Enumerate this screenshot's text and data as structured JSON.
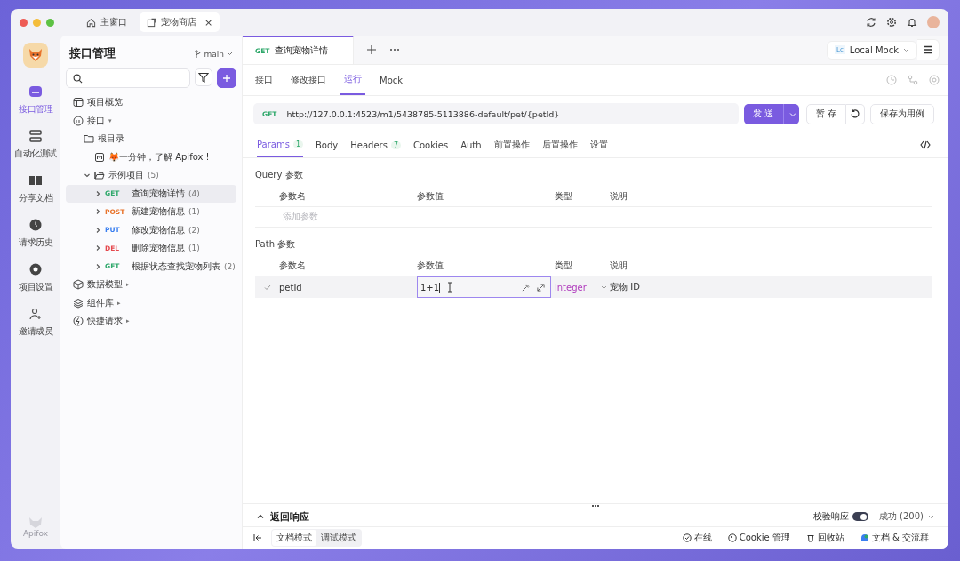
{
  "window": {
    "tabs": [
      {
        "label": "主窗口",
        "kind": "home",
        "selected": false
      },
      {
        "label": "宠物商店",
        "kind": "project",
        "selected": true,
        "close": "×"
      }
    ]
  },
  "rail": {
    "items": [
      {
        "label": "接口管理",
        "kind": "api",
        "selected": true
      },
      {
        "label": "自动化测试",
        "kind": "test",
        "selected": false
      },
      {
        "label": "分享文档",
        "kind": "book",
        "selected": false
      },
      {
        "label": "请求历史",
        "kind": "clock",
        "selected": false
      },
      {
        "label": "项目设置",
        "kind": "gear",
        "selected": false
      },
      {
        "label": "邀请成员",
        "kind": "invite",
        "selected": false
      }
    ],
    "footer": "Apifox"
  },
  "sidebar": {
    "title": "接口管理",
    "branch": "main",
    "tree": [
      {
        "label": "项目概览",
        "kind": "overview",
        "selected": false
      },
      {
        "label": "接口",
        "kind": "api",
        "selected": false,
        "caret": "▾",
        "children": [
          {
            "label": "根目录",
            "kind": "folder",
            "selected": false,
            "children": [
              {
                "label": "🦊一分钟，了解 Apifox !",
                "kind": "doc",
                "selected": false
              }
            ]
          },
          {
            "label": "示例项目",
            "kind": "folder-open",
            "count": "(5)",
            "expanded": true,
            "selected": false,
            "children": [
              {
                "label": "查询宠物详情",
                "kind": "endpoint",
                "method": "GET",
                "color": "#2fa86b",
                "count": "(4)",
                "expanded": false,
                "selected": true
              },
              {
                "label": "新建宠物信息",
                "kind": "endpoint",
                "method": "POST",
                "color": "#e8742c",
                "count": "(1)",
                "expanded": false,
                "selected": false
              },
              {
                "label": "修改宠物信息",
                "kind": "endpoint",
                "method": "PUT",
                "color": "#3a7ff0",
                "count": "(2)",
                "expanded": false,
                "selected": false
              },
              {
                "label": "删除宠物信息",
                "kind": "endpoint",
                "method": "DEL",
                "color": "#e5484d",
                "count": "(1)",
                "expanded": false,
                "selected": false
              },
              {
                "label": "根据状态查找宠物列表",
                "kind": "endpoint",
                "method": "GET",
                "color": "#2fa86b",
                "count": "(2)",
                "expanded": false,
                "selected": false
              }
            ]
          }
        ]
      },
      {
        "label": "数据模型",
        "kind": "model",
        "caret": "▸",
        "selected": false
      },
      {
        "label": "组件库",
        "kind": "components",
        "caret": "▸",
        "selected": false
      },
      {
        "label": "快捷请求",
        "kind": "quick",
        "caret": "▸",
        "selected": false
      }
    ]
  },
  "main": {
    "doc_tabs": [
      {
        "method": "GET",
        "label": "查询宠物详情",
        "selected": true
      }
    ],
    "environment": "Local Mock",
    "environment_badge": "Lc",
    "sub_tabs": [
      {
        "label": "接口",
        "selected": false
      },
      {
        "label": "修改接口",
        "selected": false
      },
      {
        "label": "运行",
        "selected": true
      },
      {
        "label": "Mock",
        "selected": false
      }
    ],
    "request": {
      "method": "GET",
      "url": "http://127.0.0.1:4523/m1/5438785-5113886-default/pet/{petId}"
    },
    "buttons": {
      "send": "发 送",
      "save": "暂 存",
      "save_case": "保存为用例"
    },
    "param_tabs": [
      {
        "label": "Params",
        "count": "1",
        "selected": true
      },
      {
        "label": "Body",
        "selected": false
      },
      {
        "label": "Headers",
        "count": "7",
        "selected": false
      },
      {
        "label": "Cookies",
        "selected": false
      },
      {
        "label": "Auth",
        "selected": false
      },
      {
        "label": "前置操作",
        "selected": false
      },
      {
        "label": "后置操作",
        "selected": false
      },
      {
        "label": "设置",
        "selected": false
      }
    ],
    "query": {
      "title": "Query 参数",
      "columns": [
        "参数名",
        "参数值",
        "类型",
        "说明"
      ],
      "placeholder": "添加参数"
    },
    "path": {
      "title": "Path 参数",
      "columns": [
        "参数名",
        "参数值",
        "类型",
        "说明"
      ],
      "rows": [
        {
          "checked": true,
          "name": "petId",
          "value": "1+1",
          "type": "integer",
          "description": "宠物 ID"
        }
      ]
    }
  },
  "response": {
    "title": "返回响应",
    "validate": "校验响应",
    "validate_on": true,
    "status": "成功 (200)"
  },
  "status_bar": {
    "modes": [
      {
        "label": "文档模式",
        "selected": true
      },
      {
        "label": "调试模式",
        "selected": false
      }
    ],
    "links": [
      {
        "label": "在线",
        "kind": "check"
      },
      {
        "label": "Cookie 管理",
        "kind": "cookie"
      },
      {
        "label": "回收站",
        "kind": "trash"
      },
      {
        "label": "文档 & 交流群",
        "kind": "chat"
      }
    ]
  }
}
